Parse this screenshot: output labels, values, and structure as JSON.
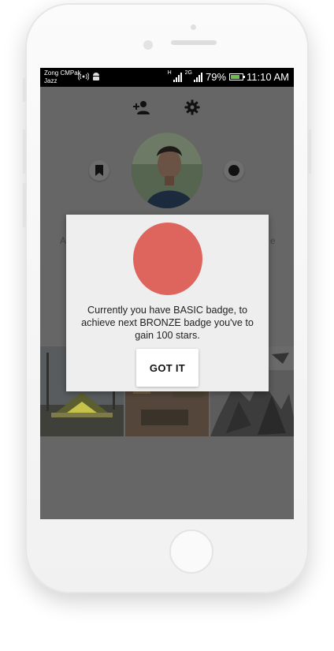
{
  "status_bar": {
    "carrier_line1": "Zong CMPak",
    "carrier_line2": "Jazz",
    "net1": "H",
    "net2": "2G",
    "battery": "79%",
    "time": "11:10 AM"
  },
  "toolbar": {
    "add_friend_icon": "person-add-icon",
    "settings_icon": "gear-icon"
  },
  "profile": {
    "bookmark_icon": "bookmark-icon",
    "record_icon": "dot-icon"
  },
  "background_peek": {
    "left": "A",
    "right": "e"
  },
  "dialog": {
    "message": "Currently you have BASIC badge, to achieve next BRONZE badge you've to gain 100 stars.",
    "button_label": "GOT IT",
    "badge_color": "#de645e"
  },
  "colors": {
    "overlay": "#666666",
    "dialog_bg": "#eeeeee"
  }
}
